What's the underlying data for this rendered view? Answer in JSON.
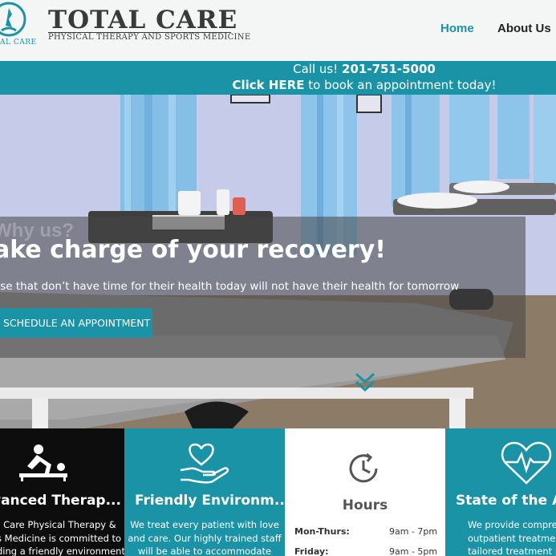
{
  "brand": {
    "mark_text": "TAL CARE",
    "name": "TOTAL CARE",
    "tagline": "PHYSICAL THERAPY AND SPORTS MEDICINE"
  },
  "nav": {
    "items": [
      {
        "label": "Home",
        "active": true
      },
      {
        "label": "About Us",
        "active": false
      }
    ]
  },
  "callbar": {
    "call_prefix": "Call us!",
    "phone": "201-751-5000",
    "book_link": "Click HERE",
    "book_rest": "to book an appointment today!"
  },
  "hero": {
    "why": "Why us?",
    "title": "ake charge of your recovery!",
    "subtitle": "ose that don’t have time for their health today will not have their health for tomorrow",
    "button": "SCHEDULE AN APPOINTMENT"
  },
  "features": [
    {
      "title": "vanced Therap...",
      "lines": [
        "l Care Physical Therapy &",
        "s Medicine is committed to",
        "ding a friendly environment"
      ],
      "icon": "massage-therapy-icon"
    },
    {
      "title": "Friendly Environm...",
      "lines": [
        "We treat every patient with love",
        "and care. Our highly trained staff",
        "will be able to accommodate"
      ],
      "icon": "heart-hand-icon"
    },
    {
      "title": "State of the Ar",
      "lines": [
        "We provide comprehe",
        "outpatient treatmen",
        "tailored treatment p"
      ],
      "icon": "heartbeat-icon"
    }
  ],
  "hours": {
    "title": "Hours",
    "rows": [
      {
        "day": "Mon-Thurs:",
        "time": "9am - 7pm"
      },
      {
        "day": "Friday:",
        "time": "9am - 5pm"
      }
    ],
    "icon": "clock-icon"
  },
  "colors": {
    "teal": "#1a93a6",
    "dark": "#0d0d0d",
    "text": "#3a3a3a"
  }
}
